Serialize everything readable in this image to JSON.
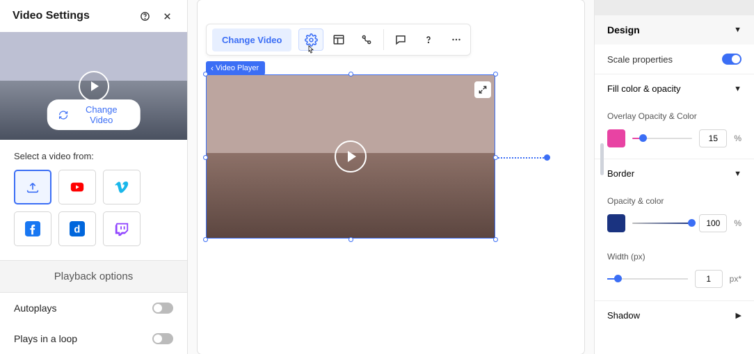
{
  "left": {
    "title": "Video Settings",
    "change_video": "Change Video",
    "select_label": "Select a video from:",
    "playback_head": "Playback options",
    "autoplays": "Autoplays",
    "loop": "Plays in a loop"
  },
  "canvas": {
    "toolbar": {
      "change_video": "Change Video"
    },
    "badge": "Video Player"
  },
  "right": {
    "design": "Design",
    "scale_props": "Scale properties",
    "fill_opacity": "Fill color & opacity",
    "overlay_label": "Overlay Opacity & Color",
    "overlay_value": "15",
    "overlay_unit": "%",
    "border": "Border",
    "opacity_color": "Opacity & color",
    "opacity_value": "100",
    "opacity_unit": "%",
    "width_label": "Width (px)",
    "width_value": "1",
    "width_unit": "px*",
    "shadow": "Shadow"
  },
  "colors": {
    "accent": "#3b6ef5",
    "overlay_swatch": "#e843a3",
    "border_swatch": "#1a3380"
  },
  "sources": [
    {
      "name": "upload",
      "active": true
    },
    {
      "name": "youtube",
      "active": false
    },
    {
      "name": "vimeo",
      "active": false
    },
    {
      "name": "facebook",
      "active": false
    },
    {
      "name": "dailymotion",
      "active": false
    },
    {
      "name": "twitch",
      "active": false
    }
  ]
}
